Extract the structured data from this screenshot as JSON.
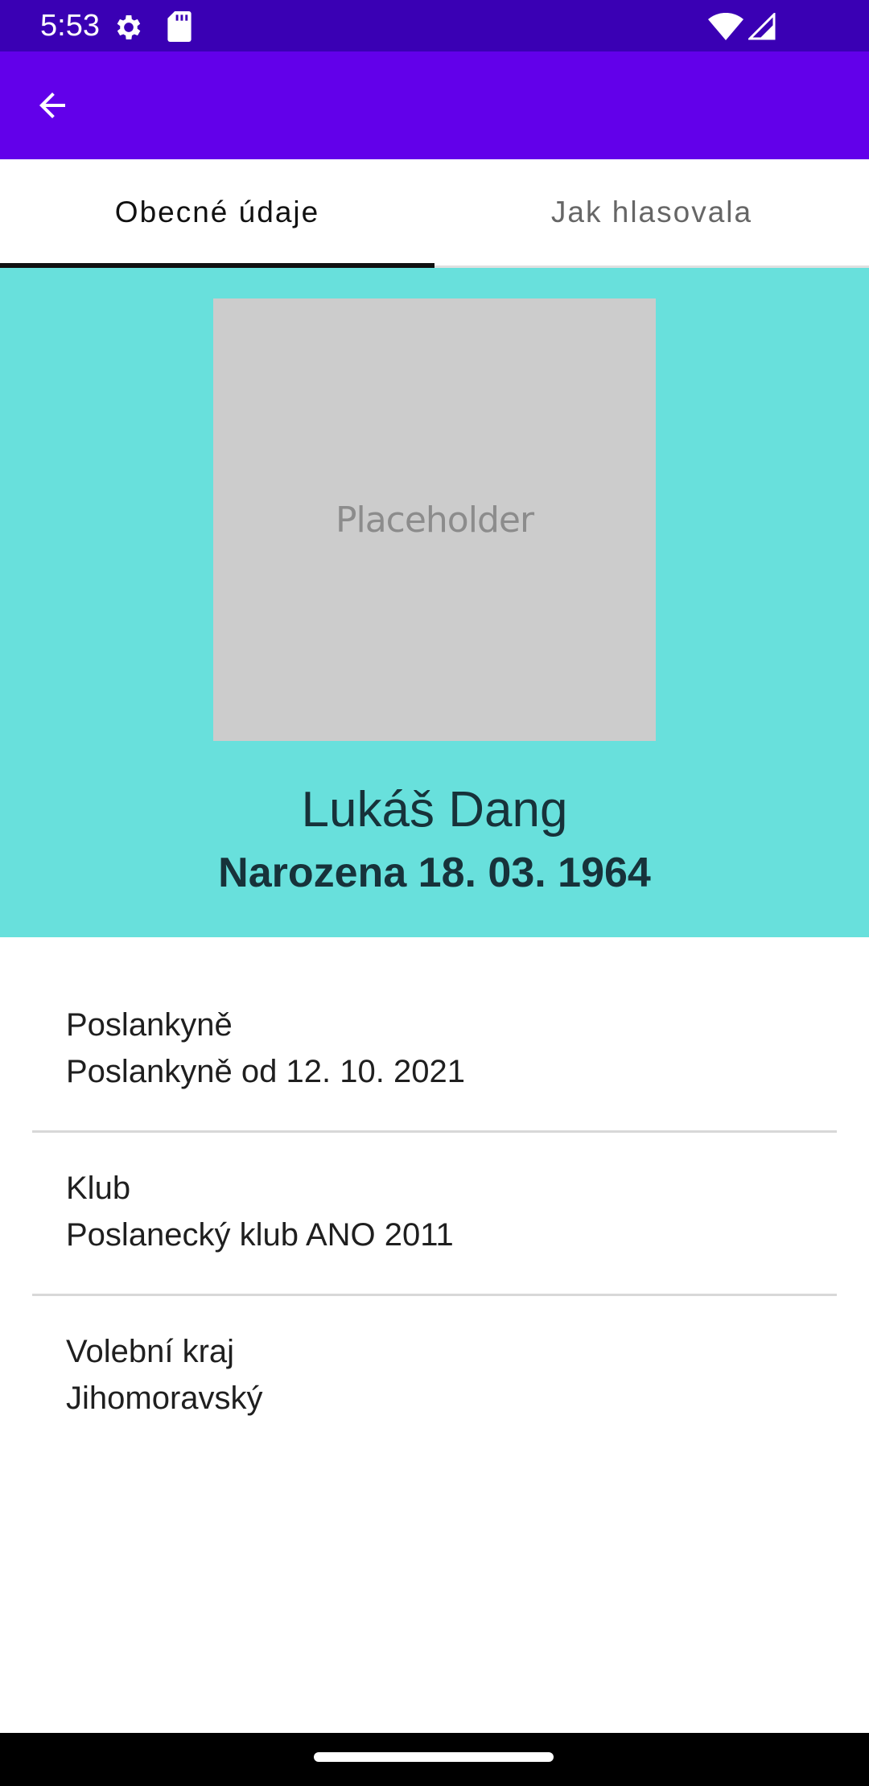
{
  "status_bar": {
    "time": "5:53",
    "icons": [
      "gear-icon",
      "sd-card-icon",
      "wifi-icon",
      "signal-icon"
    ]
  },
  "app_bar": {
    "back_icon": "arrow-left-icon",
    "color": "#6200ea"
  },
  "tabs": [
    {
      "label": "Obecné údaje",
      "selected": true
    },
    {
      "label": "Jak hlasovala",
      "selected": false
    }
  ],
  "header": {
    "photo_placeholder": "Placeholder",
    "name": "Lukáš Dang",
    "birth": "Narozena 18. 03. 1964",
    "background_color": "#68e0dc"
  },
  "info": [
    {
      "label": "Poslankyně",
      "value": "Poslankyně od 12. 10. 2021"
    },
    {
      "label": "Klub",
      "value": "Poslanecký klub ANO 2011"
    },
    {
      "label": "Volební kraj",
      "value": "Jihomoravský"
    }
  ]
}
